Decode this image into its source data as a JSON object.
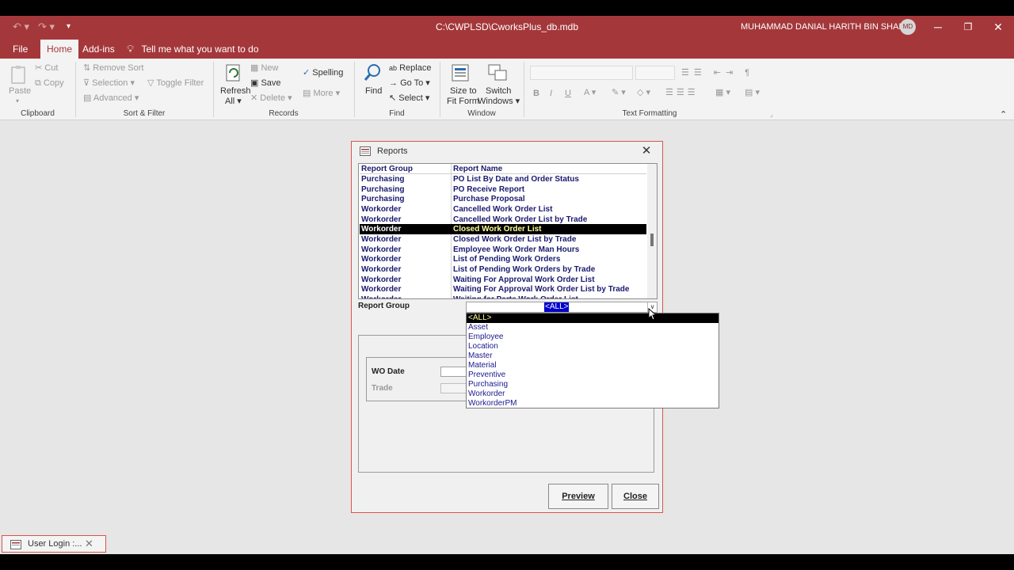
{
  "window": {
    "title": "C:\\CWPLSD\\CworksPlus_db.mdb",
    "user_name": "MUHAMMAD DANIAL HARITH BIN SHAFIE.",
    "user_initials": "MD"
  },
  "menu": {
    "tabs": [
      {
        "label": "File"
      },
      {
        "label": "Home"
      },
      {
        "label": "Add-ins"
      }
    ],
    "active_tab": "Home",
    "tell_me": "Tell me what you want to do"
  },
  "ribbon": {
    "clipboard": {
      "paste": "Paste",
      "cut": "Cut",
      "copy": "Copy",
      "group": "Clipboard"
    },
    "sort_filter": {
      "remove_sort": "Remove Sort",
      "selection": "Selection",
      "advanced": "Advanced",
      "toggle_filter": "Toggle Filter",
      "group": "Sort & Filter"
    },
    "records": {
      "refresh": "Refresh",
      "refresh_sub": "All",
      "new": "New",
      "save": "Save",
      "delete": "Delete",
      "spelling": "Spelling",
      "more": "More",
      "group": "Records"
    },
    "find": {
      "find": "Find",
      "replace": "Replace",
      "goto": "Go To",
      "select": "Select",
      "group": "Find"
    },
    "window": {
      "size_to": "Size to",
      "fit_form": "Fit Form",
      "switch": "Switch",
      "windows": "Windows",
      "group": "Window"
    },
    "text_formatting": {
      "bold": "B",
      "italic": "I",
      "underline": "U",
      "group": "Text Formatting"
    }
  },
  "dialog": {
    "title": "Reports",
    "columns": {
      "group": "Report Group",
      "name": "Report Name"
    },
    "rows": [
      {
        "group": "Purchasing",
        "name": "PO List By Date and Order Status"
      },
      {
        "group": "Purchasing",
        "name": "PO Receive Report"
      },
      {
        "group": "Purchasing",
        "name": "Purchase Proposal"
      },
      {
        "group": "Workorder",
        "name": "Cancelled Work Order List"
      },
      {
        "group": "Workorder",
        "name": "Cancelled Work Order List by Trade"
      },
      {
        "group": "Workorder",
        "name": "Closed Work Order List"
      },
      {
        "group": "Workorder",
        "name": "Closed Work Order List by Trade"
      },
      {
        "group": "Workorder",
        "name": "Employee Work Order Man Hours"
      },
      {
        "group": "Workorder",
        "name": "List of Pending Work Orders"
      },
      {
        "group": "Workorder",
        "name": "List of Pending Work Orders by Trade"
      },
      {
        "group": "Workorder",
        "name": "Waiting For Approval Work Order List"
      },
      {
        "group": "Workorder",
        "name": "Waiting For Approval Work Order List by Trade"
      },
      {
        "group": "Workorder",
        "name": "Waiting for Parts Work Order List"
      }
    ],
    "selected_row": 5,
    "report_group_label": "Report Group",
    "report_group_value": "<ALL>",
    "wo_date_label": "WO Date",
    "trade_label": "Trade",
    "preview_button": "Preview",
    "close_button": "Close"
  },
  "dropdown": {
    "options": [
      {
        "label": "<ALL>"
      },
      {
        "label": "Asset"
      },
      {
        "label": "Employee"
      },
      {
        "label": "Location"
      },
      {
        "label": "Master"
      },
      {
        "label": "Material"
      },
      {
        "label": "Preventive"
      },
      {
        "label": "Purchasing"
      },
      {
        "label": "Workorder"
      },
      {
        "label": "WorkorderPM"
      }
    ],
    "selected_index": 0
  },
  "bottom_tab": {
    "label": "User Login :..."
  },
  "colors": {
    "accent": "#a4373a",
    "dialog_border": "#d9534f",
    "list_text": "#1a1a6e",
    "selection": "#000000"
  }
}
